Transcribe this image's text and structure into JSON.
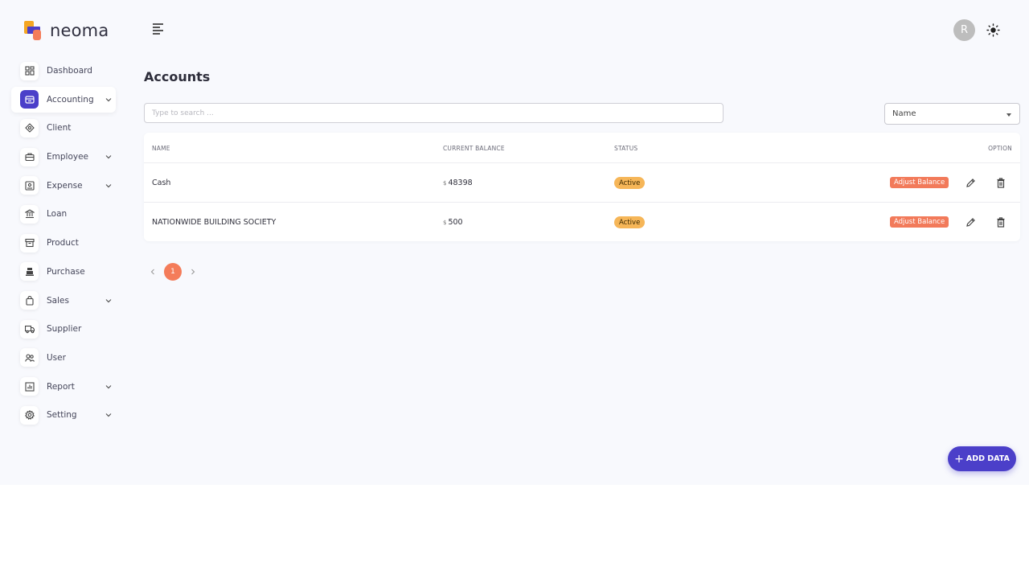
{
  "brand": {
    "name": "neoma"
  },
  "header": {
    "avatar_initial": "R"
  },
  "sidebar": {
    "items": [
      {
        "label": "Dashboard",
        "icon": "dashboard-icon",
        "has_submenu": false
      },
      {
        "label": "Accounting",
        "icon": "wallet-icon",
        "has_submenu": true,
        "active": true
      },
      {
        "label": "Client",
        "icon": "client-icon",
        "has_submenu": false
      },
      {
        "label": "Employee",
        "icon": "briefcase-icon",
        "has_submenu": true
      },
      {
        "label": "Expense",
        "icon": "expense-icon",
        "has_submenu": true
      },
      {
        "label": "Loan",
        "icon": "bank-icon",
        "has_submenu": false
      },
      {
        "label": "Product",
        "icon": "archive-icon",
        "has_submenu": false
      },
      {
        "label": "Purchase",
        "icon": "register-icon",
        "has_submenu": false
      },
      {
        "label": "Sales",
        "icon": "shopping-bag-icon",
        "has_submenu": true
      },
      {
        "label": "Supplier",
        "icon": "truck-icon",
        "has_submenu": false
      },
      {
        "label": "User",
        "icon": "users-icon",
        "has_submenu": false
      },
      {
        "label": "Report",
        "icon": "report-icon",
        "has_submenu": true
      },
      {
        "label": "Setting",
        "icon": "gear-icon",
        "has_submenu": true
      }
    ]
  },
  "main": {
    "title": "Accounts",
    "search": {
      "placeholder": "Type to search ...",
      "value": ""
    },
    "sort": {
      "selected": "Name"
    },
    "table": {
      "columns": [
        "NAME",
        "CURRENT BALANCE",
        "STATUS",
        "OPTION"
      ],
      "rows": [
        {
          "name": "Cash",
          "currency": "$",
          "balance": "48398",
          "status": "Active",
          "action": "Adjust Balance"
        },
        {
          "name": "NATIONWIDE BUILDING SOCIETY",
          "currency": "$",
          "balance": "500",
          "status": "Active",
          "action": "Adjust Balance"
        }
      ]
    },
    "pagination": {
      "current_page": "1"
    },
    "add_button": "ADD DATA"
  },
  "colors": {
    "primary": "#4b3fc9",
    "accent": "#f47c5a",
    "status_active": "#f6b658",
    "background": "#f8f9fd"
  }
}
